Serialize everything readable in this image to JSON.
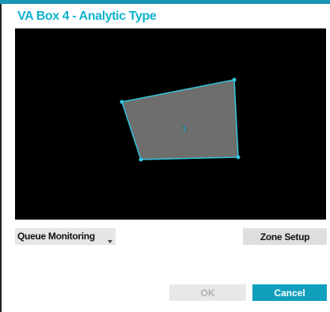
{
  "dialog": {
    "title": "VA Box 4 - Analytic Type"
  },
  "video": {
    "zone_label": "1",
    "zone_color": "#33c6e0",
    "zone_fill": "#6e6e6e",
    "background": "#000000"
  },
  "controls": {
    "analytic_select_value": "Queue Monitoring",
    "zone_setup_label": "Zone Setup"
  },
  "footer": {
    "ok_label": "OK",
    "ok_enabled": false,
    "cancel_label": "Cancel"
  },
  "colors": {
    "accent": "#11b3cf",
    "cancel_button": "#109fbd",
    "top_bar": "#1a95b3"
  },
  "icons": {
    "dropdown": "chevron-down-icon"
  }
}
